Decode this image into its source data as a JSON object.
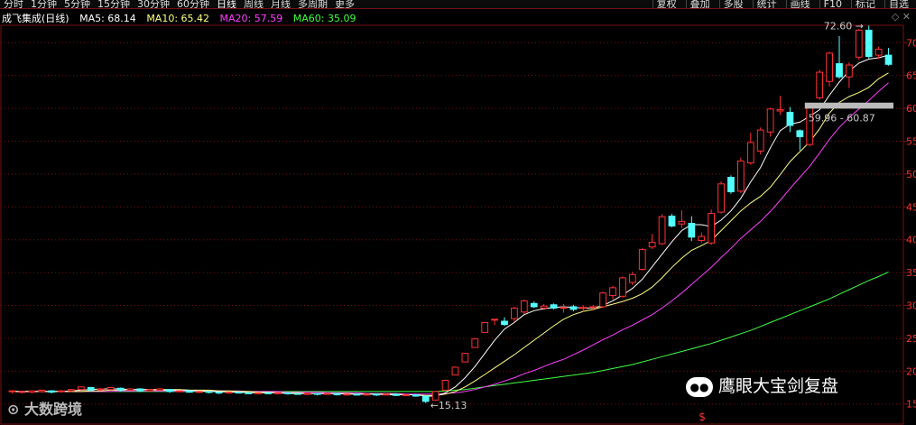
{
  "toolbar": {
    "periods": [
      "分时",
      "1分钟",
      "5分钟",
      "15分钟",
      "30分钟",
      "60分钟",
      "日线",
      "周线",
      "月线",
      "多周期",
      "更多"
    ],
    "active_period": "日线",
    "tools": [
      "复权",
      "叠加",
      "多股",
      "统计",
      "画线",
      "F10",
      "标记",
      "自选"
    ]
  },
  "legend": {
    "title": "成飞集成(日线)",
    "ma5": "MA5: 68.14",
    "ma10": "MA10: 65.42",
    "ma20": "MA20: 57.59",
    "ma60": "MA60: 35.09"
  },
  "colors": {
    "up": "#ff3232",
    "down": "#54ffff",
    "ma5": "#ffffff",
    "ma10": "#ffff80",
    "ma20": "#ff40ff",
    "ma60": "#40ff40",
    "grid": "#7a1010"
  },
  "watermark": {
    "left": "大数跨境",
    "right": "鹰眼大宝剑复盘",
    "icon": "wechat-icon"
  },
  "chart_data": {
    "type": "candlestick",
    "title": "成飞集成(日线)",
    "ylim": [
      14,
      71
    ],
    "y_ticks": [
      15,
      20,
      25,
      30,
      35,
      40,
      45,
      50,
      55,
      60,
      65,
      70
    ],
    "annotations": {
      "high_label": "72.60",
      "low_label": "15.13",
      "band_label": "59.96 - 60.87",
      "band_low": 59.96,
      "band_high": 60.87,
      "dollar_marker": "$"
    },
    "candles": [
      [
        16.9,
        17.0,
        16.6,
        17.1
      ],
      [
        16.8,
        16.9,
        16.6,
        17.0
      ],
      [
        16.8,
        17.0,
        16.6,
        17.1
      ],
      [
        16.9,
        17.1,
        16.7,
        17.2
      ],
      [
        17.0,
        16.8,
        16.6,
        17.1
      ],
      [
        16.9,
        17.0,
        16.7,
        17.1
      ],
      [
        17.0,
        17.2,
        16.8,
        17.3
      ],
      [
        17.2,
        17.6,
        17.0,
        17.7
      ],
      [
        17.5,
        17.1,
        16.9,
        17.6
      ],
      [
        17.2,
        17.3,
        17.0,
        17.4
      ],
      [
        17.2,
        17.5,
        17.1,
        17.6
      ],
      [
        17.4,
        17.1,
        16.9,
        17.5
      ],
      [
        17.1,
        17.3,
        17.0,
        17.4
      ],
      [
        17.3,
        17.0,
        16.8,
        17.4
      ],
      [
        17.0,
        17.2,
        16.9,
        17.3
      ],
      [
        17.1,
        17.3,
        17.0,
        17.4
      ],
      [
        17.2,
        16.9,
        16.7,
        17.3
      ],
      [
        16.9,
        17.0,
        16.8,
        17.1
      ],
      [
        17.0,
        16.8,
        16.7,
        17.1
      ],
      [
        16.8,
        16.9,
        16.7,
        17.0
      ],
      [
        16.9,
        16.8,
        16.6,
        17.0
      ],
      [
        16.8,
        16.7,
        16.5,
        16.9
      ],
      [
        16.7,
        16.8,
        16.6,
        16.9
      ],
      [
        16.8,
        16.7,
        16.6,
        16.9
      ],
      [
        16.7,
        16.6,
        16.5,
        16.8
      ],
      [
        16.6,
        16.7,
        16.5,
        16.8
      ],
      [
        16.7,
        16.6,
        16.5,
        16.8
      ],
      [
        16.6,
        16.7,
        16.5,
        16.8
      ],
      [
        16.7,
        16.6,
        16.4,
        16.8
      ],
      [
        16.6,
        16.5,
        16.4,
        16.7
      ],
      [
        16.5,
        16.6,
        16.4,
        16.7
      ],
      [
        16.6,
        16.5,
        16.3,
        16.7
      ],
      [
        16.5,
        16.6,
        16.4,
        16.7
      ],
      [
        16.6,
        16.4,
        16.3,
        16.7
      ],
      [
        16.4,
        16.5,
        16.3,
        16.6
      ],
      [
        16.5,
        16.4,
        16.3,
        16.6
      ],
      [
        16.4,
        16.5,
        16.3,
        16.6
      ],
      [
        16.5,
        16.4,
        16.2,
        16.6
      ],
      [
        16.4,
        16.5,
        16.3,
        16.6
      ],
      [
        16.5,
        16.3,
        16.2,
        16.6
      ],
      [
        16.3,
        16.4,
        16.2,
        16.5
      ],
      [
        16.4,
        16.2,
        16.1,
        16.5
      ],
      [
        16.2,
        15.4,
        15.13,
        16.3
      ],
      [
        15.6,
        16.9,
        15.5,
        17.0
      ],
      [
        17.1,
        18.6,
        17.1,
        18.7
      ],
      [
        19.4,
        20.6,
        19.4,
        20.7
      ],
      [
        21.4,
        22.7,
        21.4,
        22.8
      ],
      [
        23.6,
        24.9,
        23.6,
        25.0
      ],
      [
        25.9,
        27.4,
        25.9,
        27.5
      ],
      [
        27.8,
        27.9,
        27.0,
        27.9
      ],
      [
        27.6,
        27.1,
        26.9,
        28.2
      ],
      [
        28.0,
        29.6,
        27.5,
        29.8
      ],
      [
        29.0,
        30.7,
        28.7,
        30.9
      ],
      [
        30.3,
        29.8,
        29.6,
        30.6
      ],
      [
        29.6,
        29.9,
        29.3,
        30.2
      ],
      [
        30.1,
        29.6,
        29.4,
        30.3
      ],
      [
        29.6,
        29.7,
        28.9,
        30.2
      ],
      [
        29.8,
        29.4,
        29.1,
        30.1
      ],
      [
        29.6,
        29.7,
        29.0,
        30.0
      ],
      [
        29.7,
        29.8,
        29.2,
        30.1
      ],
      [
        29.8,
        31.9,
        29.6,
        32.1
      ],
      [
        31.5,
        32.7,
        30.9,
        33.0
      ],
      [
        31.4,
        34.2,
        31.2,
        34.4
      ],
      [
        33.5,
        34.7,
        33.1,
        35.1
      ],
      [
        35.5,
        38.5,
        35.3,
        38.7
      ],
      [
        38.9,
        39.6,
        38.6,
        40.9
      ],
      [
        39.4,
        43.5,
        39.2,
        43.9
      ],
      [
        43.6,
        42.1,
        41.9,
        43.9
      ],
      [
        42.4,
        42.8,
        41.8,
        44.5
      ],
      [
        42.5,
        40.4,
        39.8,
        43.6
      ],
      [
        39.9,
        40.5,
        39.5,
        41.1
      ],
      [
        39.5,
        44.0,
        39.2,
        44.6
      ],
      [
        44.2,
        48.5,
        44.0,
        48.9
      ],
      [
        49.5,
        47.3,
        47.0,
        49.8
      ],
      [
        47.4,
        52.0,
        47.1,
        52.5
      ],
      [
        51.7,
        54.8,
        51.4,
        56.3
      ],
      [
        53.5,
        56.7,
        53.0,
        57.1
      ],
      [
        56.4,
        59.9,
        55.7,
        60.1
      ],
      [
        59.6,
        59.8,
        59.0,
        61.9
      ],
      [
        59.4,
        57.4,
        56.4,
        60.2
      ],
      [
        56.6,
        55.7,
        53.6,
        56.8
      ],
      [
        54.5,
        60.4,
        54.2,
        60.4
      ],
      [
        61.6,
        65.5,
        61.3,
        65.9
      ],
      [
        64.1,
        68.4,
        63.3,
        68.6
      ],
      [
        66.8,
        64.8,
        64.5,
        71.0
      ],
      [
        64.8,
        66.6,
        63.1,
        67.0
      ],
      [
        67.8,
        71.9,
        67.4,
        72.1
      ],
      [
        71.9,
        67.9,
        67.6,
        72.6
      ],
      [
        68.1,
        69.0,
        67.5,
        69.4
      ],
      [
        68.1,
        66.7,
        66.5,
        69.2
      ]
    ],
    "ma5": [
      16.9,
      16.9,
      16.9,
      16.9,
      16.9,
      16.9,
      17.0,
      17.1,
      17.2,
      17.3,
      17.3,
      17.3,
      17.2,
      17.2,
      17.2,
      17.1,
      17.1,
      17.1,
      17.1,
      17.0,
      16.9,
      16.9,
      16.8,
      16.8,
      16.7,
      16.7,
      16.7,
      16.7,
      16.6,
      16.6,
      16.6,
      16.6,
      16.6,
      16.6,
      16.5,
      16.5,
      16.5,
      16.5,
      16.4,
      16.4,
      16.4,
      16.4,
      16.2,
      16.2,
      16.7,
      17.6,
      19.0,
      20.7,
      22.7,
      24.7,
      26.4,
      27.4,
      28.6,
      29.2,
      29.5,
      29.7,
      29.8,
      29.7,
      29.6,
      29.6,
      30.0,
      30.7,
      31.6,
      32.6,
      34.0,
      35.9,
      37.8,
      39.7,
      41.4,
      42.3,
      42.3,
      42.0,
      43.0,
      44.4,
      46.3,
      48.8,
      51.0,
      54.0,
      56.6,
      57.6,
      57.9,
      58.8,
      59.8,
      62.0,
      64.0,
      65.7,
      66.9,
      67.5,
      67.7,
      68.1
    ],
    "ma10": [
      16.9,
      16.9,
      16.9,
      16.9,
      16.9,
      16.9,
      16.9,
      16.9,
      17.0,
      17.0,
      17.1,
      17.1,
      17.2,
      17.2,
      17.2,
      17.2,
      17.2,
      17.2,
      17.1,
      17.1,
      17.1,
      17.0,
      17.0,
      16.9,
      16.9,
      16.8,
      16.8,
      16.7,
      16.7,
      16.7,
      16.6,
      16.6,
      16.6,
      16.6,
      16.6,
      16.5,
      16.5,
      16.5,
      16.5,
      16.5,
      16.4,
      16.4,
      16.3,
      16.3,
      16.5,
      16.9,
      17.6,
      18.5,
      19.5,
      20.5,
      21.5,
      22.5,
      23.6,
      24.7,
      25.8,
      26.9,
      27.9,
      28.6,
      29.1,
      29.4,
      29.8,
      30.2,
      30.6,
      31.1,
      31.8,
      32.8,
      34.2,
      35.8,
      37.2,
      38.4,
      39.1,
      39.9,
      41.4,
      42.9,
      44.4,
      45.6,
      46.6,
      48.0,
      49.9,
      51.9,
      53.4,
      54.9,
      56.9,
      59.3,
      60.9,
      61.8,
      62.4,
      63.2,
      64.5,
      65.4
    ],
    "ma20": [
      16.9,
      16.9,
      16.9,
      16.9,
      16.9,
      16.9,
      16.9,
      16.9,
      16.9,
      16.9,
      16.9,
      17.0,
      17.0,
      17.0,
      17.0,
      17.0,
      17.0,
      17.0,
      17.0,
      17.0,
      17.0,
      17.0,
      17.0,
      17.0,
      16.9,
      16.9,
      16.9,
      16.9,
      16.8,
      16.8,
      16.8,
      16.8,
      16.7,
      16.7,
      16.7,
      16.7,
      16.6,
      16.6,
      16.6,
      16.6,
      16.5,
      16.5,
      16.5,
      16.5,
      16.6,
      16.7,
      16.9,
      17.2,
      17.6,
      18.0,
      18.5,
      19.0,
      19.6,
      20.1,
      20.7,
      21.3,
      21.8,
      22.5,
      23.2,
      24.0,
      24.8,
      25.5,
      26.3,
      27.0,
      27.8,
      28.6,
      29.6,
      30.7,
      31.9,
      33.2,
      34.5,
      35.8,
      37.3,
      38.7,
      40.2,
      41.5,
      42.8,
      44.3,
      46.0,
      47.8,
      49.5,
      51.2,
      53.2,
      55.3,
      57.1,
      58.6,
      59.9,
      61.2,
      62.6,
      63.9
    ],
    "ma60": [
      16.9,
      16.9,
      16.9,
      16.9,
      16.9,
      16.9,
      16.9,
      16.9,
      16.9,
      16.9,
      16.9,
      16.9,
      16.9,
      16.9,
      16.9,
      16.9,
      16.9,
      16.9,
      16.9,
      16.9,
      16.9,
      16.9,
      16.9,
      16.9,
      16.9,
      16.9,
      16.9,
      16.9,
      16.9,
      16.9,
      16.9,
      16.9,
      16.9,
      16.9,
      16.9,
      16.9,
      16.9,
      16.9,
      16.9,
      16.9,
      16.9,
      16.9,
      16.9,
      16.9,
      17.0,
      17.1,
      17.2,
      17.4,
      17.6,
      17.8,
      18.0,
      18.2,
      18.4,
      18.6,
      18.8,
      19.0,
      19.2,
      19.4,
      19.6,
      19.8,
      20.1,
      20.4,
      20.7,
      21.0,
      21.4,
      21.8,
      22.2,
      22.6,
      23.0,
      23.4,
      23.8,
      24.2,
      24.7,
      25.2,
      25.7,
      26.2,
      26.8,
      27.4,
      28.0,
      28.6,
      29.2,
      29.8,
      30.4,
      31.0,
      31.7,
      32.4,
      33.1,
      33.8,
      34.4,
      35.1
    ]
  }
}
